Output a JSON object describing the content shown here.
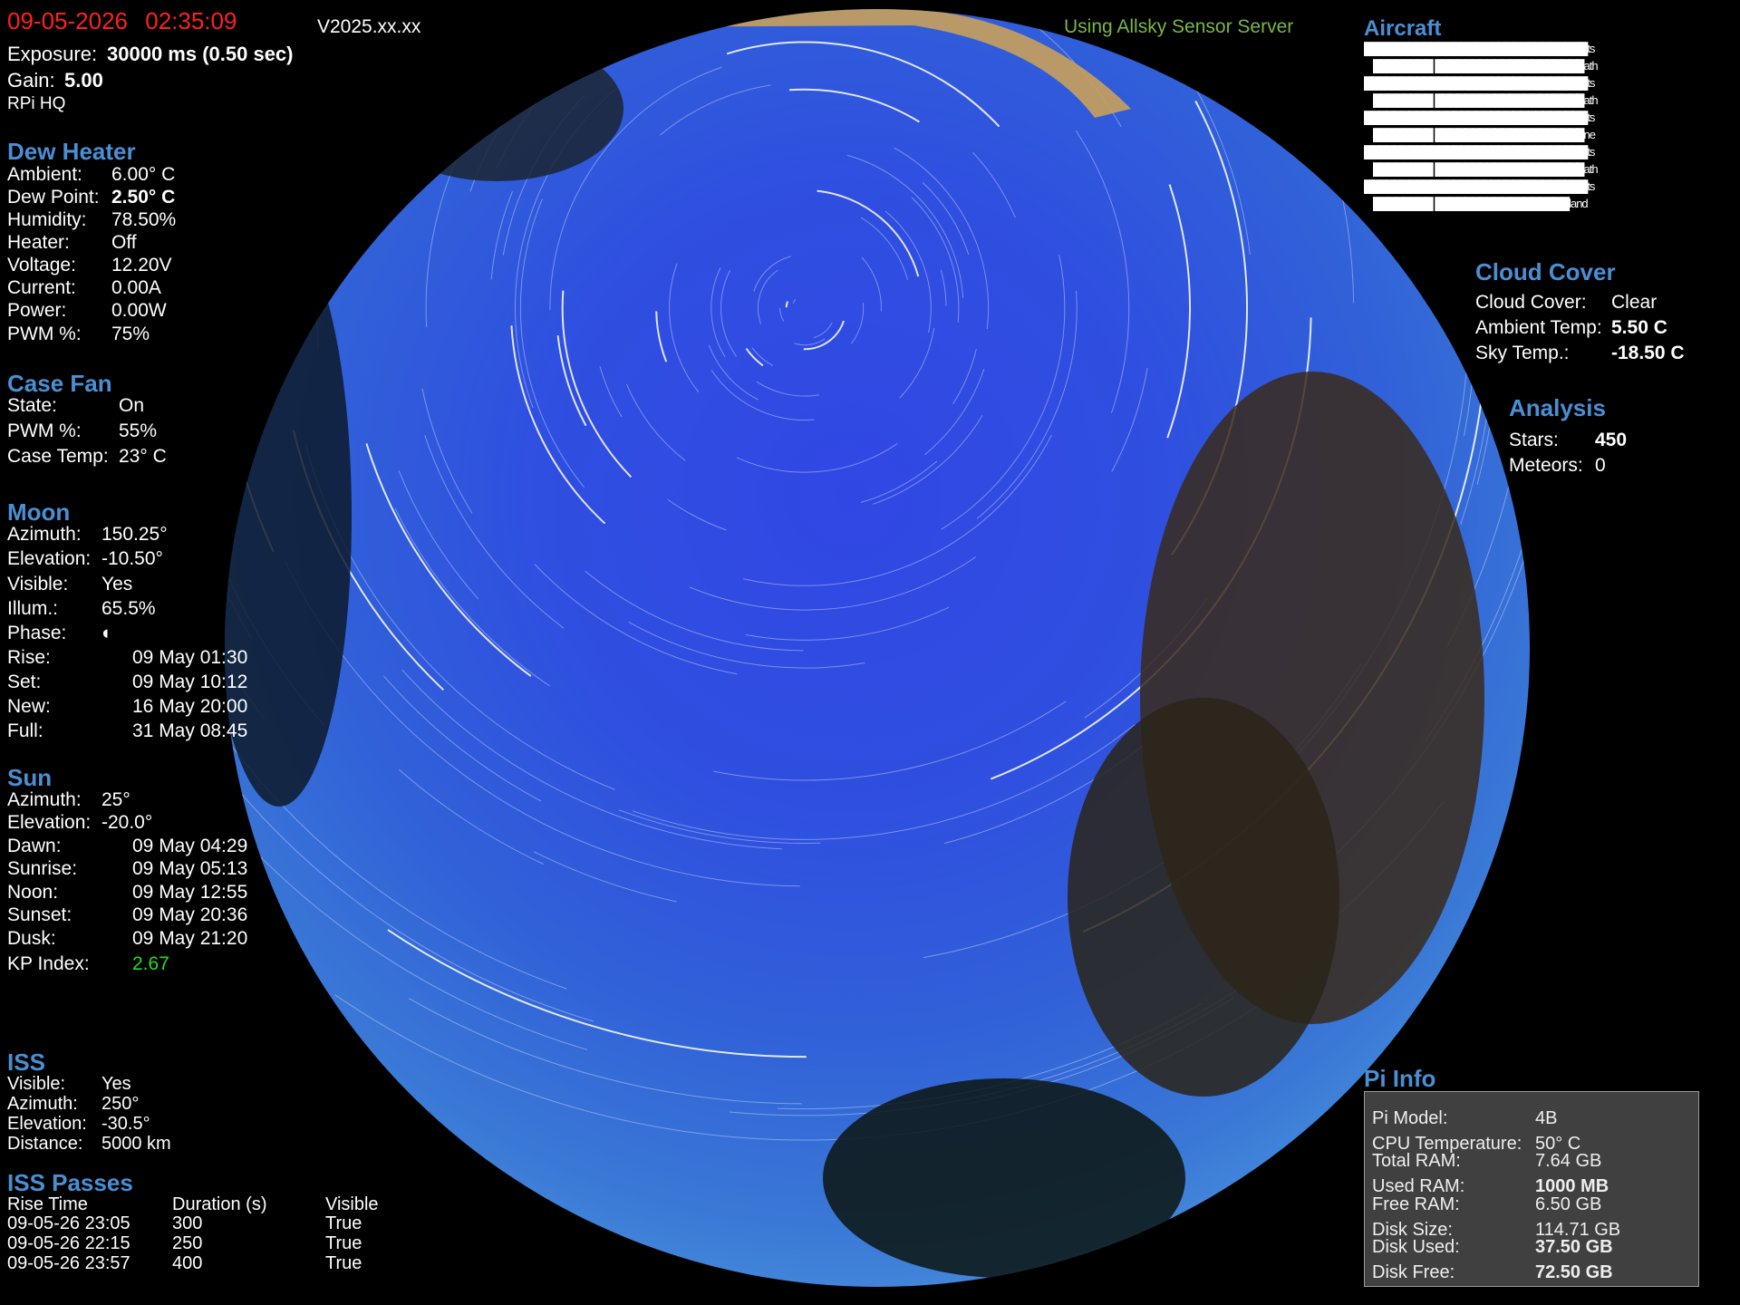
{
  "header": {
    "date": "09-05-2026",
    "time": "02:35:09",
    "version": "V2025.xx.xx",
    "sensor_server": "Using Allsky Sensor Server",
    "exposure_label": "Exposure:",
    "exposure_value": "30000 ms (0.50 sec)",
    "gain_label": "Gain:",
    "gain_value": "5.00",
    "camera": "RPi  HQ",
    "date_color": "#ff2020"
  },
  "dew_heater": {
    "title": "Dew Heater",
    "items": [
      {
        "label": "Ambient:",
        "value": "6.00° C"
      },
      {
        "label": "Dew Point:",
        "value": "2.50° C"
      },
      {
        "label": "Humidity:",
        "value": "78.50%"
      },
      {
        "label": "Heater:",
        "value": "Off"
      },
      {
        "label": "Voltage:",
        "value": "12.20V"
      },
      {
        "label": "Current:",
        "value": "0.00A"
      },
      {
        "label": "Power:",
        "value": "0.00W"
      },
      {
        "label": "PWM %:",
        "value": "75%"
      }
    ]
  },
  "case_fan": {
    "title": "Case Fan",
    "items": [
      {
        "label": "State:",
        "value": "On"
      },
      {
        "label": "PWM %:",
        "value": "55%"
      },
      {
        "label": "Case Temp:",
        "value": "23° C"
      }
    ]
  },
  "moon": {
    "title": "Moon",
    "items": [
      {
        "label": "Azimuth:",
        "value": "150.25°"
      },
      {
        "label": "Elevation:",
        "value": "-10.50°"
      },
      {
        "label": "Visible:",
        "value": "Yes"
      },
      {
        "label": "Illum.:",
        "value": "65.5%"
      },
      {
        "label": "Phase:",
        "value": "◐"
      },
      {
        "label": "Rise:",
        "value": "09 May 01:30"
      },
      {
        "label": "Set:",
        "value": "09 May 10:12"
      },
      {
        "label": "New:",
        "value": "16 May 20:00"
      },
      {
        "label": "Full:",
        "value": "31 May 08:45"
      }
    ]
  },
  "sun": {
    "title": "Sun",
    "items": [
      {
        "label": "Azimuth:",
        "value": "25°"
      },
      {
        "label": "Elevation:",
        "value": "-20.0°"
      },
      {
        "label": "Dawn:",
        "value": "09 May 04:29"
      },
      {
        "label": "Sunrise:",
        "value": "09 May 05:13"
      },
      {
        "label": "Noon:",
        "value": "09 May 12:55"
      },
      {
        "label": "Sunset:",
        "value": "09 May 20:36"
      },
      {
        "label": "Dusk:",
        "value": "09 May 21:20"
      }
    ],
    "kp_label": "KP Index:",
    "kp_value": "2.67",
    "kp_color": "#22dd22"
  },
  "iss": {
    "title": "ISS",
    "items": [
      {
        "label": "Visible:",
        "value": "Yes"
      },
      {
        "label": "Azimuth:",
        "value": "250°"
      },
      {
        "label": "Elevation:",
        "value": "-30.5°"
      },
      {
        "label": "Distance:",
        "value": "5000 km"
      }
    ]
  },
  "iss_passes": {
    "title": "ISS Passes",
    "headers": [
      "Rise Time",
      "Duration (s)",
      "Visible"
    ],
    "rows": [
      [
        "09-05-26 23:05",
        "300",
        "True"
      ],
      [
        "09-05-26 22:15",
        "250",
        "True"
      ],
      [
        "09-05-26 23:57",
        "400",
        "True"
      ]
    ]
  },
  "aircraft": {
    "title": "Aircraft",
    "lines": [
      "██████████████████████████████ts",
      "████████     ████████████████████ath",
      "██████████████████████████████ts",
      "████████     ████████████████████ath",
      "██████████████████████████████ts",
      "████████     ████████████████████ne",
      "██████████████████████████████ts",
      "████████     ████████████████████ath",
      "██████████████████████████████ts",
      "████████     ██████████████████land"
    ]
  },
  "cloud_cover": {
    "title": "Cloud Cover",
    "items": [
      {
        "label": "Cloud Cover:",
        "value": "Clear"
      },
      {
        "label": "Ambient Temp:",
        "value": "5.50 C"
      },
      {
        "label": "Sky Temp.:",
        "value": "-18.50 C"
      }
    ]
  },
  "analysis": {
    "title": "Analysis",
    "items": [
      {
        "label": "Stars:",
        "value": "450"
      },
      {
        "label": "Meteors:",
        "value": "0"
      }
    ]
  },
  "pi_info": {
    "title": "Pi Info",
    "items": [
      {
        "label": "Pi Model:",
        "value": "4B"
      },
      {
        "label": "CPU Temperature:",
        "value": "50° C"
      },
      {
        "label": "Total RAM:",
        "value": "7.64 GB"
      },
      {
        "label": "Used RAM:",
        "value": "1000 MB"
      },
      {
        "label": "Free RAM:",
        "value": "6.50 GB"
      },
      {
        "label": "Disk Size:",
        "value": "114.71 GB"
      },
      {
        "label": "Disk Used:",
        "value": "37.50 GB"
      },
      {
        "label": "Disk Free:",
        "value": "72.50 GB"
      }
    ]
  },
  "colors": {
    "section_title": "#4a8fd4",
    "sensor_server": "#7ab648",
    "panel_bg": "#404040"
  }
}
